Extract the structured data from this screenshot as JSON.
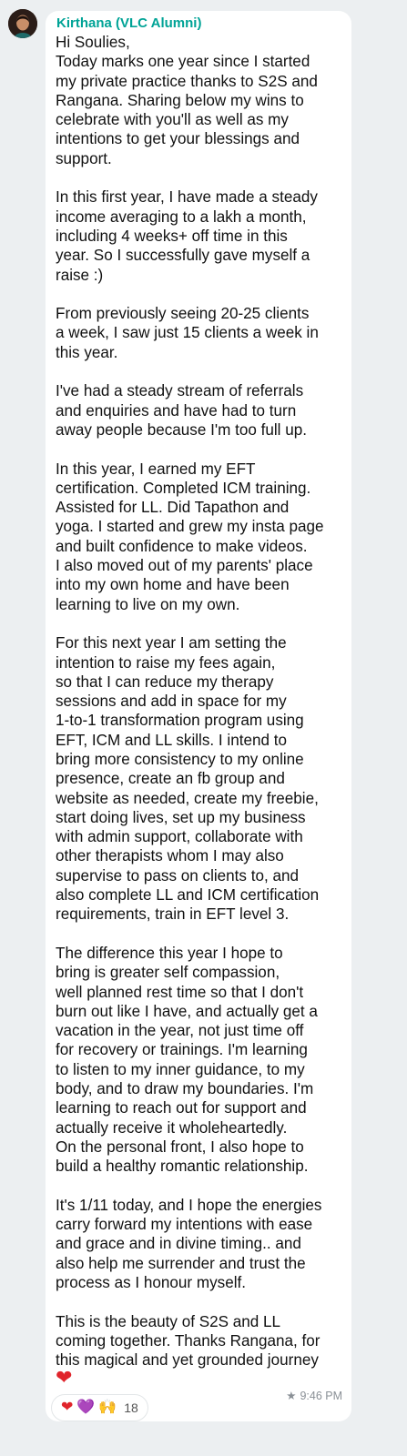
{
  "message": {
    "sender": "Kirthana (VLC Alumni)",
    "body": "Hi Soulies,\nToday marks one year since I started\nmy private practice thanks to S2S and\nRangana. Sharing below my wins to\ncelebrate with you'll as well as my\nintentions to get your blessings and\nsupport.\n\nIn this first year, I have made a steady\nincome averaging to a lakh a month,\nincluding 4 weeks+ off time in this\nyear. So I successfully gave myself a\nraise :)\n\nFrom previously seeing 20-25 clients\na week, I saw just 15 clients a week in\nthis year.\n\nI've had a steady stream of referrals\nand enquiries and have had to turn\naway people because I'm too full up.\n\nIn this year, I earned my EFT\ncertification. Completed ICM training.\nAssisted for LL. Did Tapathon and\nyoga. I started and grew my insta page\nand built confidence to make videos.\nI also moved out of my parents' place\ninto my own home and have been\nlearning to live on my own.\n\nFor this next year I am setting the\nintention to raise my fees again,\nso that I can reduce my therapy\nsessions and add in space for my\n1-to-1 transformation program using\nEFT, ICM and LL skills. I intend to\nbring more consistency to my online\npresence, create an fb group and\nwebsite as needed, create my freebie,\nstart doing lives, set up my business\nwith admin support, collaborate with\nother therapists whom I may also\nsupervise to pass on clients to, and\nalso complete LL and ICM certification\nrequirements, train in EFT level 3.\n\nThe difference this year I hope to\nbring is greater self compassion,\nwell planned rest time so that I don't\nburn out like I have, and actually get a\nvacation in the year, not just time off\nfor recovery or trainings. I'm learning\nto listen to my inner guidance, to my\nbody, and to draw my boundaries. I'm\nlearning to reach out for support and\nactually receive it wholeheartedly.\nOn the personal front, I also hope to\nbuild a healthy romantic relationship.\n\nIt's 1/11 today, and I hope the energies\ncarry forward my intentions with ease\nand grace and in divine timing.. and\nalso help me surrender and trust the\nprocess as I honour myself.\n\nThis is the beauty of S2S and LL\ncoming together. Thanks Rangana, for\nthis magical and yet grounded journey",
    "closing_emoji": "❤",
    "star_icon": "★",
    "time": "9:46 PM"
  },
  "reactions": {
    "emojis": [
      "❤",
      "💜",
      "🙌"
    ],
    "count": "18"
  },
  "colors": {
    "sender": "#00a396",
    "background": "#eceff1",
    "bubble": "#ffffff"
  }
}
